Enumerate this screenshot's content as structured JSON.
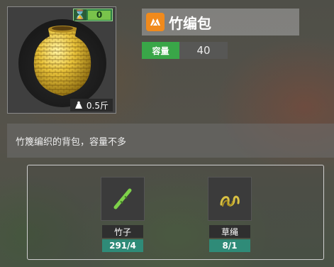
{
  "item": {
    "name": "竹编包",
    "timer_value": "0",
    "weight": "0.5斤",
    "capacity_label": "容量",
    "capacity_value": "40",
    "description": "竹篾编织的背包，容量不多"
  },
  "materials": [
    {
      "name": "竹子",
      "count": "291/4",
      "icon": "bamboo-icon"
    },
    {
      "name": "草绳",
      "count": "8/1",
      "icon": "grass-rope-icon"
    }
  ],
  "colors": {
    "accent_green": "#39a648",
    "count_teal": "#2f8b78",
    "title_icon_orange": "#f08a1c"
  }
}
